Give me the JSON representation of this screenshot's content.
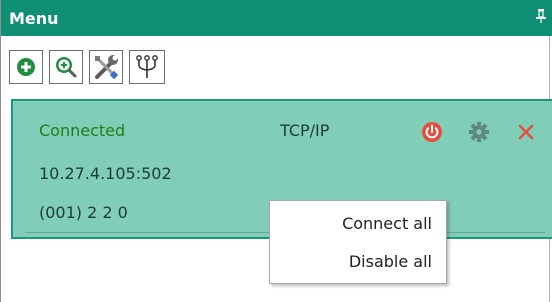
{
  "panel": {
    "title": "Menu",
    "pin_icon": "pin-icon"
  },
  "toolbar": {
    "buttons": [
      {
        "name": "add-device-button",
        "icon": "plus-circle-icon"
      },
      {
        "name": "search-device-button",
        "icon": "magnify-plus-icon"
      },
      {
        "name": "tools-button",
        "icon": "wrench-screwdriver-icon"
      },
      {
        "name": "usb-button",
        "icon": "usb-trident-icon"
      }
    ]
  },
  "device": {
    "status": "Connected",
    "protocol": "TCP/IP",
    "address": "10.27.4.105:502",
    "ids": "(001) 2 2 0",
    "actions": [
      {
        "icon": "power-icon",
        "color": "#e74c3c"
      },
      {
        "icon": "gear-icon",
        "color": "#5f8a80"
      },
      {
        "icon": "close-icon",
        "color": "#e74c3c"
      }
    ]
  },
  "context_menu": {
    "items": [
      "Connect all",
      "Disable all"
    ]
  },
  "colors": {
    "header": "#0e8f74",
    "device_bg": "#80cdb8",
    "status_green": "#1c7f18"
  }
}
